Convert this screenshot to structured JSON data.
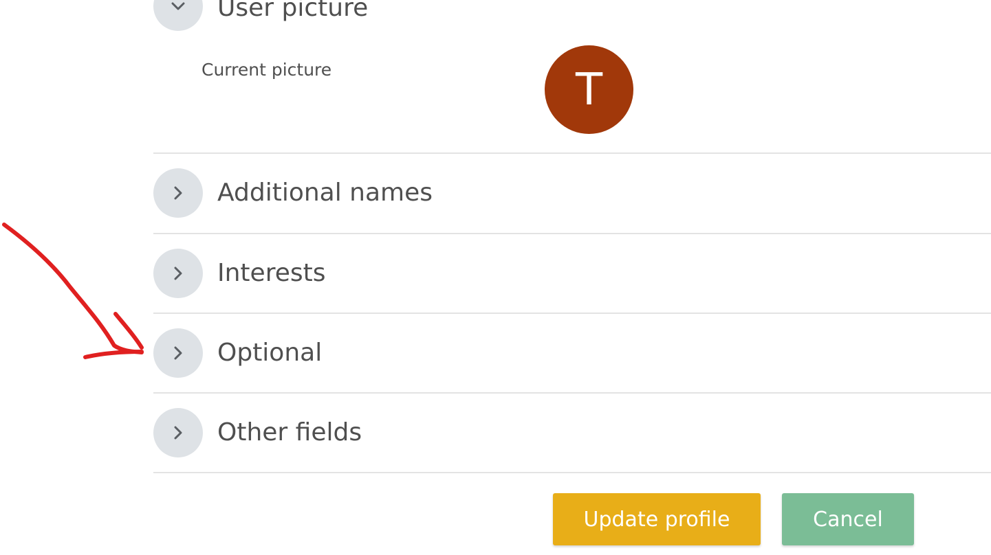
{
  "sections": {
    "user_picture": {
      "title": "User picture",
      "expanded": true
    },
    "additional_names": {
      "title": "Additional names",
      "expanded": false
    },
    "interests": {
      "title": "Interests",
      "expanded": false
    },
    "optional": {
      "title": "Optional",
      "expanded": false
    },
    "other_fields": {
      "title": "Other fields",
      "expanded": false
    }
  },
  "user_picture": {
    "current_label": "Current picture",
    "avatar_initial": "T",
    "avatar_color": "#a1380a"
  },
  "buttons": {
    "update_label": "Update profile",
    "cancel_label": "Cancel"
  },
  "icons": {
    "expanded": "chevron-down-icon",
    "collapsed": "chevron-right-icon"
  },
  "colors": {
    "update_button": "#e8ae18",
    "cancel_button": "#7bbd96",
    "annotation_arrow": "#e02020"
  }
}
